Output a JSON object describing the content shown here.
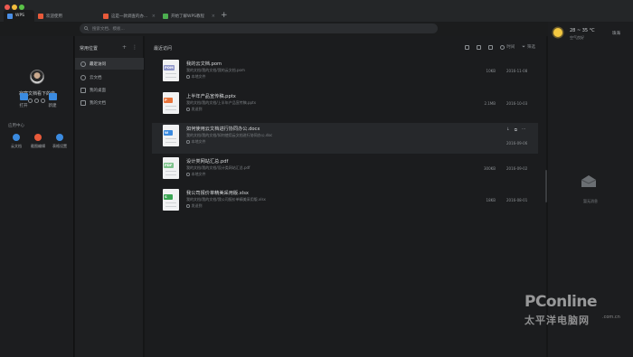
{
  "window": {
    "tabs": [
      {
        "label": "WPS",
        "icon": "wps-logo-icon",
        "color": "#4a8fe7"
      },
      {
        "label": "欢迎使用",
        "icon": "doc-tab-icon",
        "color": "#e85a3a"
      },
      {
        "label": "这是一款调查的办...",
        "icon": "pdf-tab-icon",
        "color": "#e85a3a"
      },
      {
        "label": "开始了解WPS教程",
        "icon": "sheet-tab-icon",
        "color": "#4cae4f"
      }
    ],
    "add_tab_label": "+"
  },
  "search": {
    "placeholder": "搜索文档、模板..."
  },
  "user": {
    "name": "寂寞文档看下的音",
    "avatar": "avatar",
    "tiles": [
      {
        "label": "打开",
        "icon": "folder-icon",
        "color": "#3b8be0"
      },
      {
        "label": "新建",
        "icon": "new-doc-icon",
        "color": "#3b8be0"
      }
    ],
    "app_center_label": "应用中心",
    "apps": [
      {
        "label": "云文档",
        "icon": "cloud-icon",
        "color": "#3b8be0"
      },
      {
        "label": "截图编辑",
        "icon": "screenshot-icon",
        "color": "#e85a3a"
      },
      {
        "label": "表格设置",
        "icon": "settings-icon",
        "color": "#3b8be0"
      }
    ]
  },
  "nav": {
    "header": "常用位置",
    "add_label": "+",
    "more_label": "⋮",
    "items": [
      {
        "label": "最近访问",
        "icon": "clock-icon"
      },
      {
        "label": "云文档",
        "icon": "cloud-doc-icon"
      },
      {
        "label": "我的桌面",
        "icon": "desktop-icon"
      },
      {
        "label": "我的文档",
        "icon": "documents-icon"
      }
    ]
  },
  "main": {
    "header": "最近访问",
    "tools": {
      "filter_label": "时间",
      "sort_label": "筛选"
    },
    "files": [
      {
        "name": "我的云文档.pom",
        "path": "我的文档/我的文档/我的云文档.pom",
        "source": "本地文件",
        "size": "10KB",
        "date": "2016-11-08",
        "badge": "POM",
        "badge_color": "#8e95c9"
      },
      {
        "name": "上半年产品宣传稿.pptx",
        "path": "我的文档/我的文档/上半年产品宣传稿.pptx",
        "source": "发送到",
        "size": "2.1MB",
        "date": "2016-10-03",
        "badge": "P",
        "badge_color": "#e8743a"
      },
      {
        "name": "如何使用云文档进行协同办公.docx",
        "path": "我的文档/我的文档/如何使用云文档进行协同办公.doc",
        "source": "本地文件",
        "size": "",
        "date": "2016-09-06",
        "badge": "W",
        "badge_color": "#3b8be0",
        "actions": [
          "↓",
          "⧉",
          "···"
        ]
      },
      {
        "name": "设计类网站汇总.pdf",
        "path": "我的文档/我的文档/设计类网站汇总.pdf",
        "source": "本地文件",
        "size": "300KB",
        "date": "2016-09-02",
        "badge": "PDF",
        "badge_color": "#7cc28a"
      },
      {
        "name": "我公司报价单精美采用版.xlsx",
        "path": "我的文档/我的文档/我公司报价单精美采用版.xlsx",
        "source": "发送到",
        "size": "18KB",
        "date": "2016-08-01",
        "badge": "S",
        "badge_color": "#3aa553"
      }
    ]
  },
  "right": {
    "temperature": "28 ~ 35 °C",
    "weather": "空气良好",
    "city": "珠海",
    "inbox_label": "暂无消息"
  },
  "watermark": {
    "logo": "PConline",
    "domain": ".com.cn",
    "chinese": "太平洋电脑网"
  }
}
